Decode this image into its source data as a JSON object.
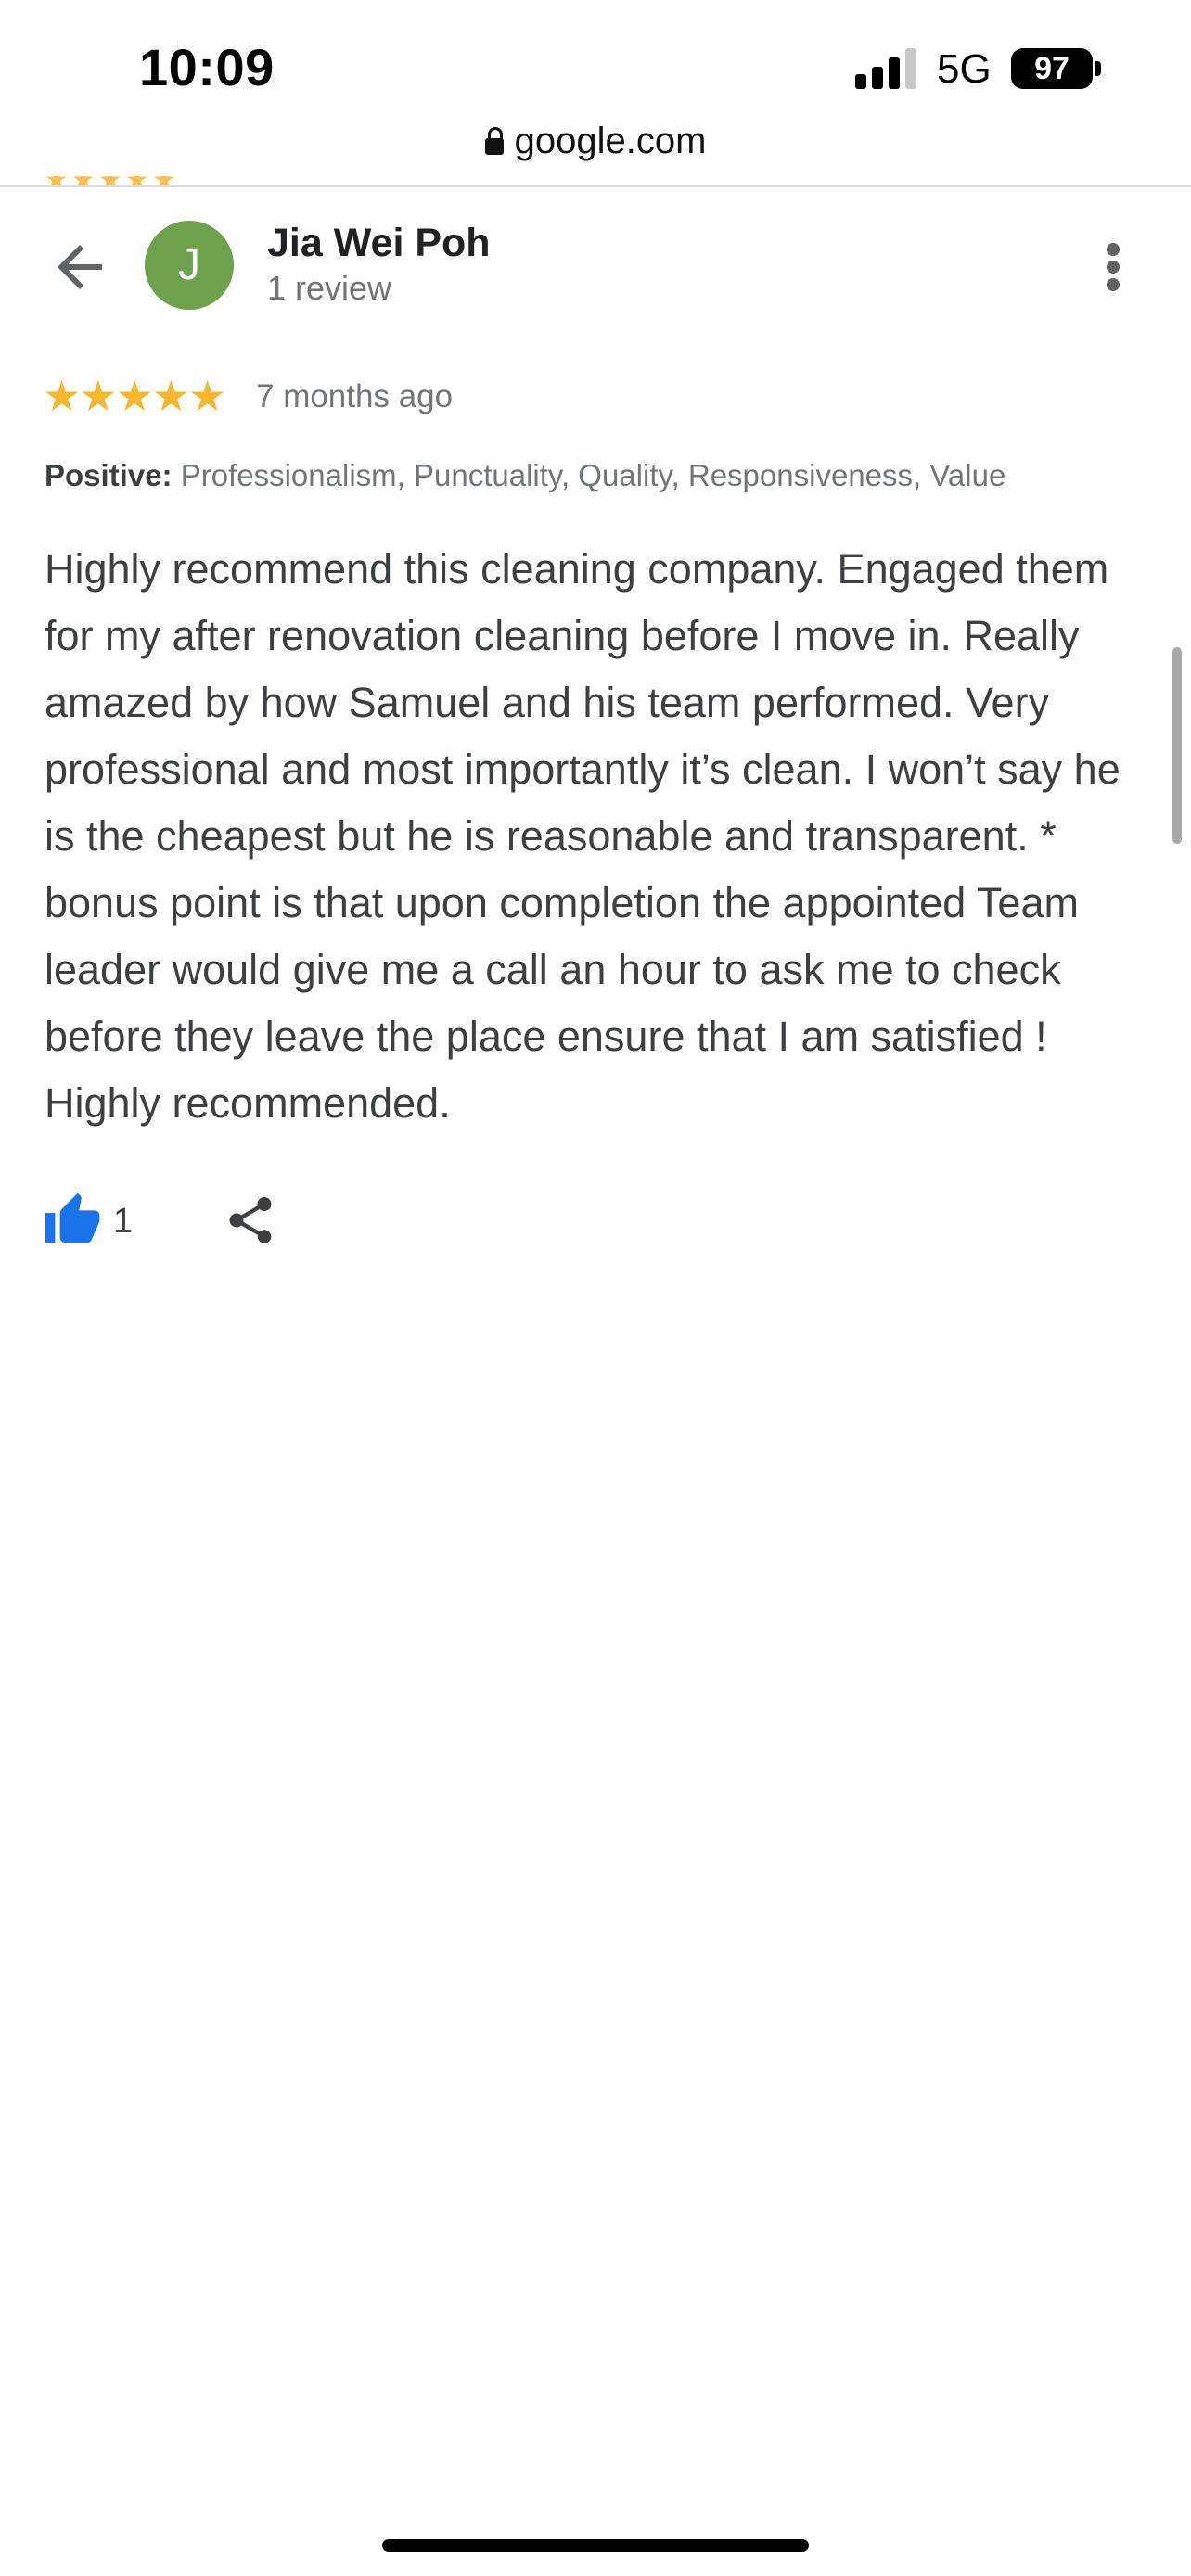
{
  "status_bar": {
    "time": "10:09",
    "network": "5G",
    "battery": "97"
  },
  "browser": {
    "url": "google.com"
  },
  "header": {
    "back_icon": "arrow-back-icon",
    "avatar_initial": "J",
    "avatar_color": "#6ea14b",
    "reviewer_name": "Jia Wei Poh",
    "review_count": "1 review",
    "more_icon": "more-vert-icon"
  },
  "review": {
    "rating": 5,
    "stars": "★★★★★",
    "star_color": "#f5b72f",
    "time_ago": "7 months ago",
    "attributes_label": "Positive:",
    "attributes_value": "Professionalism, Punctuality, Quality, Responsiveness, Value",
    "text": "Highly recommend this cleaning company. Engaged them for my after renovation cleaning before I move in. Really amazed by how Samuel and his team performed. Very professional and most importantly it’s clean. I won’t say he is the cheapest but he is reasonable and transparent. * bonus point is that upon completion the appointed Team leader would give me a call an hour to ask me to check before they leave the place ensure that I am satisfied ! Highly recommended."
  },
  "actions": {
    "like_icon": "thumbs-up-icon",
    "like_color": "#1a73e8",
    "like_count": "1",
    "share_icon": "share-icon"
  }
}
